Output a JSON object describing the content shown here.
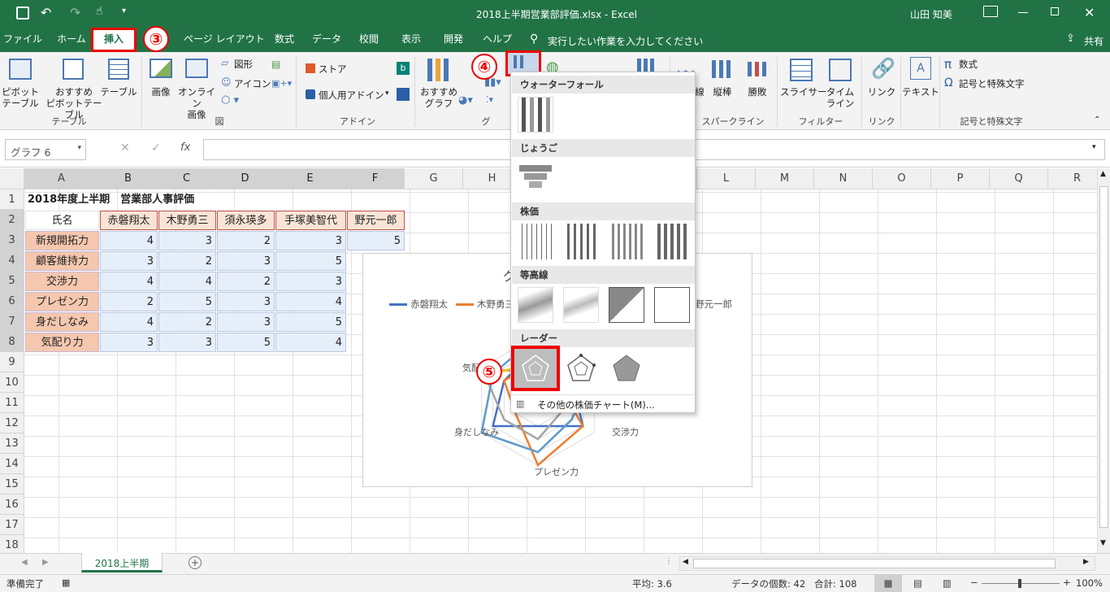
{
  "title": {
    "doc": "2018上半期営業部評価.xlsx - Excel",
    "user": "山田 知美"
  },
  "tabs": [
    "ファイル",
    "ホーム",
    "挿入",
    "ページ レイアウト",
    "数式",
    "データ",
    "校閲",
    "表示",
    "開発",
    "ヘルプ"
  ],
  "tell_me": "実行したい作業を入力してください",
  "share": "共有",
  "ribbon": {
    "pivot": "ピボット\nテーブル",
    "rec_pivot": "おすすめ\nピボットテーブル",
    "table": "テーブル",
    "group_table": "テーブル",
    "image": "画像",
    "online_image": "オンライン\n画像",
    "shapes": "図形",
    "icons": "アイコン",
    "group_fig": "図",
    "store": "ストア",
    "my_addins": "個人用アドイン",
    "group_addin": "アドイン",
    "rec_chart": "おすすめ\nグラフ",
    "group_chart": "グ",
    "line": "線",
    "column": "縦棒",
    "winloss": "勝敗",
    "group_spark": "スパークライン",
    "slicer": "スライサー",
    "timeline": "タイム\nライン",
    "group_filter": "フィルター",
    "link": "リンク",
    "group_link": "リンク",
    "text": "テキスト",
    "formula": "数式",
    "symbol": "記号と特殊文字",
    "group_symbol": "記号と特殊文字"
  },
  "namebox": "グラフ 6",
  "formula_icon": "fx",
  "columns": [
    "A",
    "B",
    "C",
    "D",
    "E",
    "F",
    "G",
    "H",
    "I",
    "J",
    "K",
    "L",
    "M",
    "N",
    "O",
    "P",
    "Q",
    "R"
  ],
  "rows": [
    "1",
    "2",
    "3",
    "4",
    "5",
    "6",
    "7",
    "8",
    "9",
    "10",
    "11",
    "12",
    "13",
    "14",
    "15",
    "16",
    "17",
    "18"
  ],
  "sheet": {
    "a1": "2018年度上半期　営業部人事評価",
    "header": [
      "氏名",
      "赤磐翔太",
      "木野勇三",
      "須永瑛多",
      "手塚美智代",
      "野元一郎"
    ],
    "labels": [
      "新規開拓力",
      "顧客維持力",
      "交渉力",
      "プレゼン力",
      "身だしなみ",
      "気配り力"
    ],
    "values": [
      [
        "4",
        "3",
        "2",
        "3",
        "5"
      ],
      [
        "3",
        "2",
        "3",
        "5",
        ""
      ],
      [
        "4",
        "4",
        "2",
        "3",
        ""
      ],
      [
        "2",
        "5",
        "3",
        "4",
        ""
      ],
      [
        "4",
        "2",
        "3",
        "5",
        ""
      ],
      [
        "3",
        "3",
        "5",
        "4",
        ""
      ]
    ]
  },
  "chart": {
    "title_frag": "グ",
    "legend": [
      "赤磐翔太",
      "木野勇三",
      "野元一郎"
    ],
    "legend_frag": "木野勇三",
    "axis_labels": [
      "気配",
      "交渉力",
      "プレゼン力",
      "身だしなみ"
    ],
    "series_colors": [
      "#4472c4",
      "#ed7d31",
      "#a5a5a5",
      "#ffc000",
      "#5b9bd5"
    ]
  },
  "dropdown": {
    "sections": [
      "ウォーターフォール",
      "じょうご",
      "株価",
      "等高線",
      "レーダー"
    ],
    "more": "その他の株価チャート(M)..."
  },
  "badges": [
    "③",
    "④",
    "⑤"
  ],
  "sheet_tab": "2018上半期",
  "status": {
    "ready": "準備完了",
    "avg": "平均: 3.6",
    "count": "データの個数: 42",
    "sum": "合計: 108",
    "zoom": "100%"
  }
}
